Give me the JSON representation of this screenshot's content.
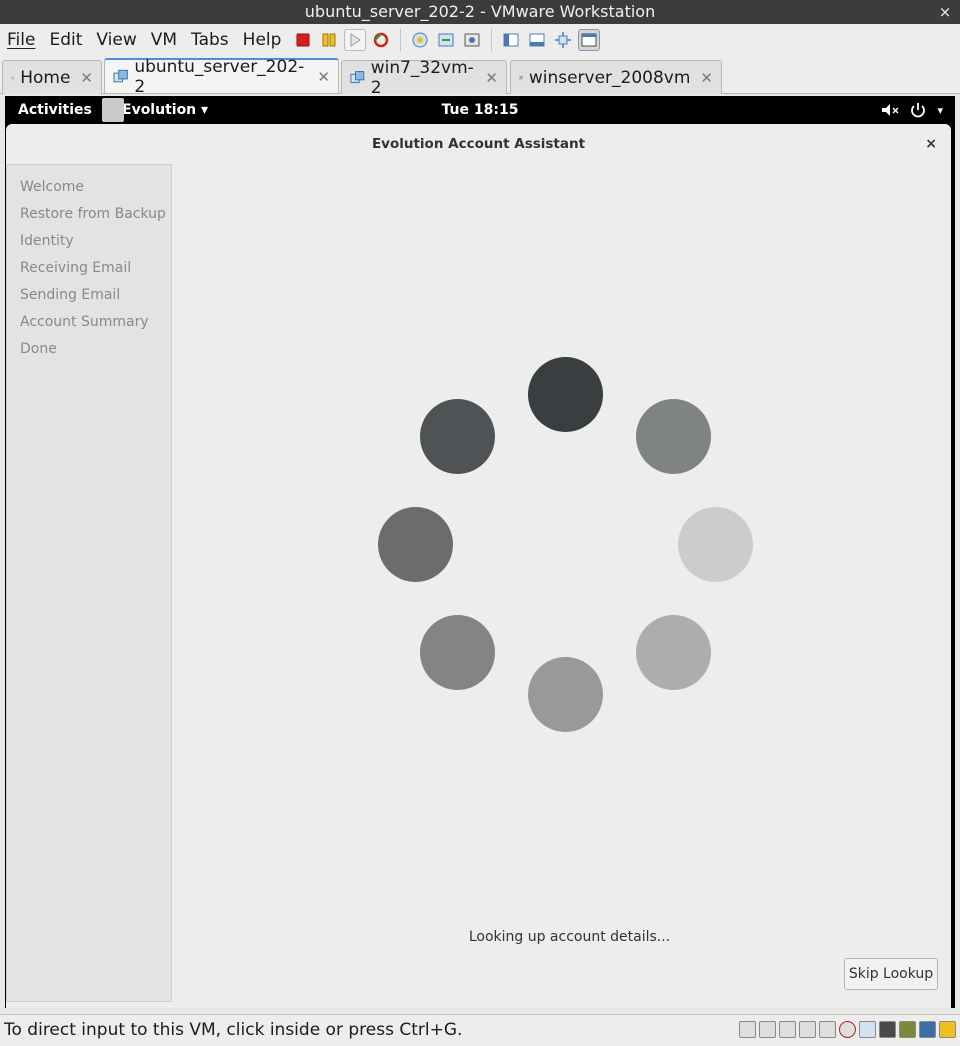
{
  "window": {
    "title": "ubuntu_server_202-2 - VMware Workstation",
    "close_glyph": "×"
  },
  "menu": [
    "File",
    "Edit",
    "View",
    "VM",
    "Tabs",
    "Help"
  ],
  "tabs": [
    {
      "label": "Home",
      "icon": "home-icon",
      "active": false
    },
    {
      "label": "ubuntu_server_202-2",
      "icon": "vm-icon",
      "active": true
    },
    {
      "label": "win7_32vm-2",
      "icon": "vm-icon",
      "active": false
    },
    {
      "label": "winserver_2008vm",
      "icon": "vm-icon",
      "active": false
    }
  ],
  "tab_close_glyph": "✕",
  "guest": {
    "topbar": {
      "activities": "Activities",
      "app_menu": "Evolution ▾",
      "clock": "Tue 18:15",
      "power_caret": "▾"
    },
    "dialog": {
      "title": "Evolution Account Assistant",
      "close_glyph": "×",
      "steps": [
        "Welcome",
        "Restore from Backup",
        "Identity",
        "Receiving Email",
        "Sending Email",
        "Account Summary",
        "Done"
      ],
      "status": "Looking up account details...",
      "skip_button": "Skip Lookup"
    },
    "spinner_colors": [
      "#3a3e41",
      "#7f8384",
      "#cbcccc",
      "#acadad",
      "#99999a",
      "#828485",
      "#6a6c6e",
      "#4f5356"
    ]
  },
  "statusbar": {
    "text": "To direct input to this VM, click inside or press Ctrl+G."
  },
  "colors": {
    "accent": "#4a90d9",
    "toolbar_red": "#d42020",
    "toolbar_yellow": "#f0c020",
    "toolbar_green": "#3a9a3a"
  }
}
